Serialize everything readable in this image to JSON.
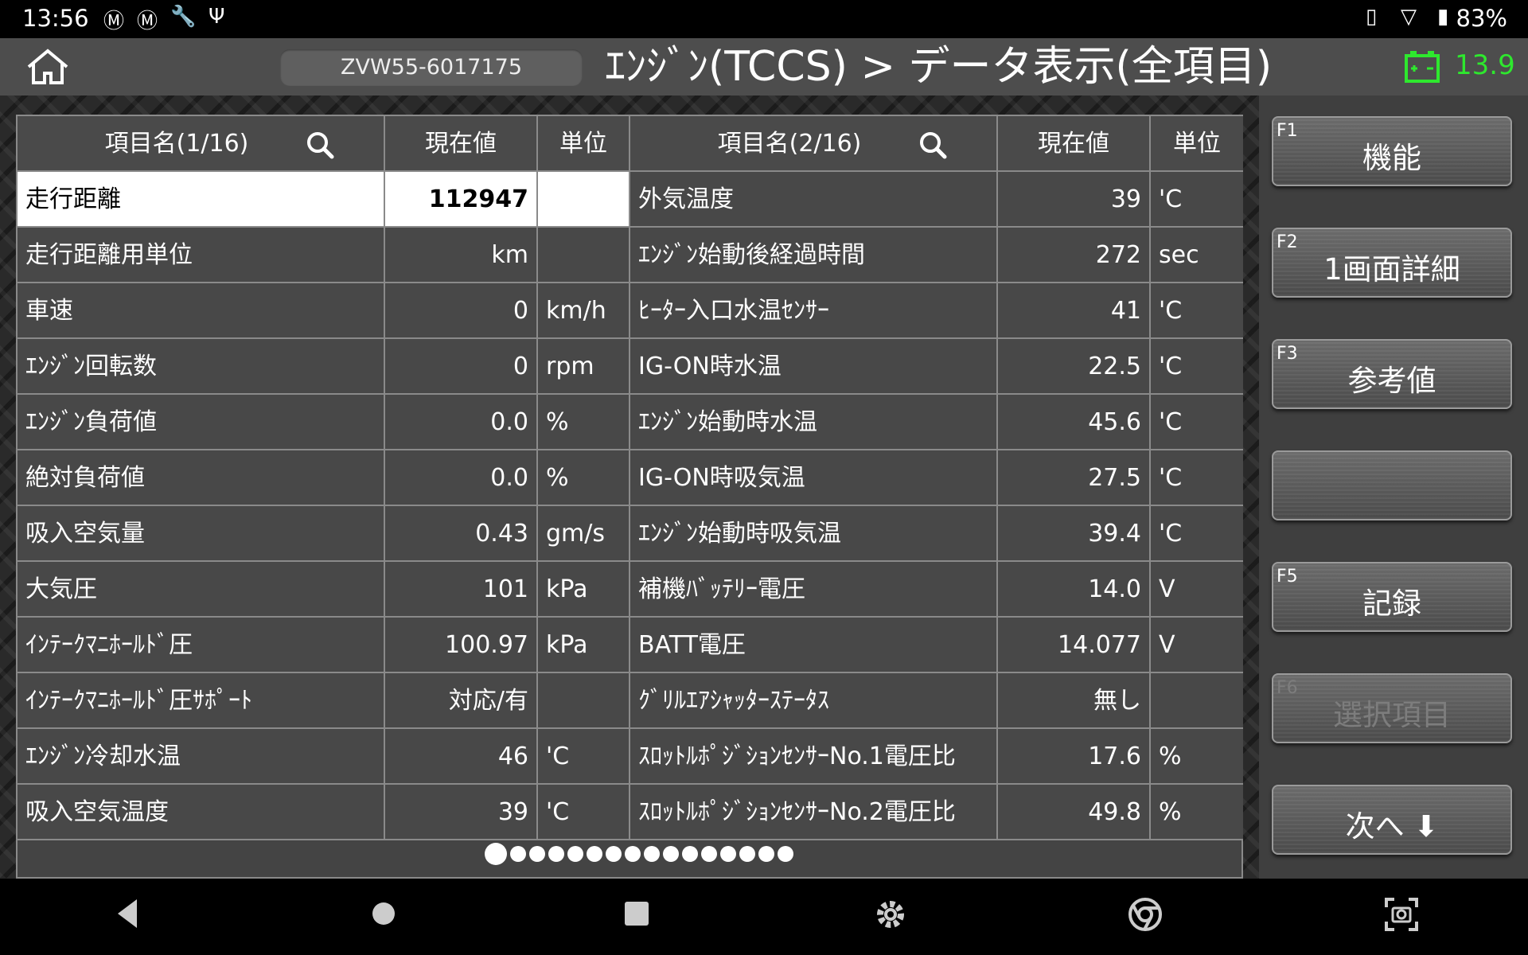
{
  "status": {
    "time": "13:56",
    "battery": "83%"
  },
  "header": {
    "vin": "ZVW55-6017175",
    "title": "ｴﾝｼﾞﾝ(TCCS) > データ表示(全項目)",
    "battery_voltage": "13.9",
    "accent_green": "#2ee82e"
  },
  "table": {
    "left_headers": {
      "name": "項目名(1/16)",
      "value": "現在値",
      "unit": "単位"
    },
    "right_headers": {
      "name": "項目名(2/16)",
      "value": "現在値",
      "unit": "単位"
    },
    "rows": [
      {
        "l_name": "走行距離",
        "l_val": "112947",
        "l_unit": "",
        "r_name": "外気温度",
        "r_val": "39",
        "r_unit": "'C"
      },
      {
        "l_name": "走行距離用単位",
        "l_val": "km",
        "l_unit": "",
        "r_name": "ｴﾝｼﾞﾝ始動後経過時間",
        "r_val": "272",
        "r_unit": "sec"
      },
      {
        "l_name": "車速",
        "l_val": "0",
        "l_unit": "km/h",
        "r_name": "ﾋｰﾀｰ入口水温ｾﾝｻｰ",
        "r_val": "41",
        "r_unit": "'C"
      },
      {
        "l_name": "ｴﾝｼﾞﾝ回転数",
        "l_val": "0",
        "l_unit": "rpm",
        "r_name": "IG-ON時水温",
        "r_val": "22.5",
        "r_unit": "'C"
      },
      {
        "l_name": "ｴﾝｼﾞﾝ負荷値",
        "l_val": "0.0",
        "l_unit": "%",
        "r_name": "ｴﾝｼﾞﾝ始動時水温",
        "r_val": "45.6",
        "r_unit": "'C"
      },
      {
        "l_name": "絶対負荷値",
        "l_val": "0.0",
        "l_unit": "%",
        "r_name": "IG-ON時吸気温",
        "r_val": "27.5",
        "r_unit": "'C"
      },
      {
        "l_name": "吸入空気量",
        "l_val": "0.43",
        "l_unit": "gm/s",
        "r_name": "ｴﾝｼﾞﾝ始動時吸気温",
        "r_val": "39.4",
        "r_unit": "'C"
      },
      {
        "l_name": "大気圧",
        "l_val": "101",
        "l_unit": "kPa",
        "r_name": "補機ﾊﾞｯﾃﾘｰ電圧",
        "r_val": "14.0",
        "r_unit": "V"
      },
      {
        "l_name": "ｲﾝﾃｰｸﾏﾆﾎｰﾙﾄﾞ圧",
        "l_val": "100.97",
        "l_unit": "kPa",
        "r_name": "BATT電圧",
        "r_val": "14.077",
        "r_unit": "V"
      },
      {
        "l_name": "ｲﾝﾃｰｸﾏﾆﾎｰﾙﾄﾞ圧ｻﾎﾟｰﾄ",
        "l_val": "対応/有",
        "l_unit": "",
        "r_name": "ｸﾞﾘﾙｴｱｼｬｯﾀｰｽﾃｰﾀｽ",
        "r_val": "無し",
        "r_unit": ""
      },
      {
        "l_name": "ｴﾝｼﾞﾝ冷却水温",
        "l_val": "46",
        "l_unit": "'C",
        "r_name": "ｽﾛｯﾄﾙﾎﾟｼﾞｼｮﾝｾﾝｻｰNo.1電圧比",
        "r_val": "17.6",
        "r_unit": "%"
      },
      {
        "l_name": "吸入空気温度",
        "l_val": "39",
        "l_unit": "'C",
        "r_name": "ｽﾛｯﾄﾙﾎﾟｼﾞｼｮﾝｾﾝｻｰNo.2電圧比",
        "r_val": "49.8",
        "r_unit": "%"
      }
    ],
    "page_count": 16,
    "current_page": 1
  },
  "functions": [
    {
      "key": "F1",
      "label": "機能",
      "enabled": true
    },
    {
      "key": "F2",
      "label": "1画面詳細",
      "enabled": true
    },
    {
      "key": "F3",
      "label": "参考値",
      "enabled": true
    },
    {
      "key": "",
      "label": "",
      "enabled": true
    },
    {
      "key": "F5",
      "label": "記録",
      "enabled": true
    },
    {
      "key": "F6",
      "label": "選択項目",
      "enabled": false
    },
    {
      "key": "",
      "label": "次へ ⬇",
      "enabled": true
    }
  ]
}
